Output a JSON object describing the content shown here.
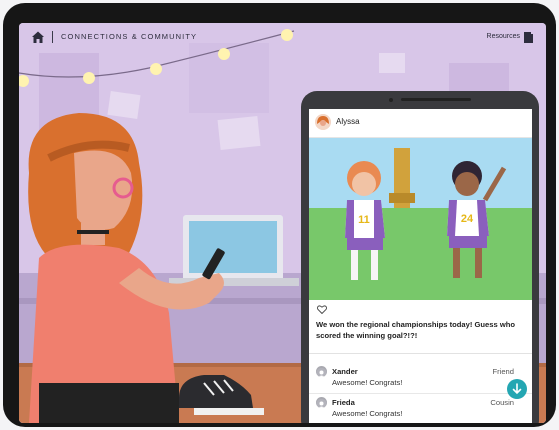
{
  "header": {
    "section_title": "CONNECTIONS & COMMUNITY",
    "resources_label": "Resources",
    "home_icon": "home-icon",
    "resources_icon": "book-icon"
  },
  "post": {
    "author": "Alyssa",
    "jersey_left": "11",
    "jersey_right": "24",
    "caption": "We won the regional championships today! Guess who scored the winning goal?!?!"
  },
  "comments": [
    {
      "name": "Xander",
      "text": "Awesome! Congrats!",
      "relation": "Friend"
    },
    {
      "name": "Frieda",
      "text": "Awesome! Congrats!",
      "relation": "Cousin"
    }
  ],
  "colors": {
    "wall": "#d8c6e8",
    "accent": "#24a6b2",
    "field": "#78c86a",
    "sky": "#a9dbf2"
  }
}
